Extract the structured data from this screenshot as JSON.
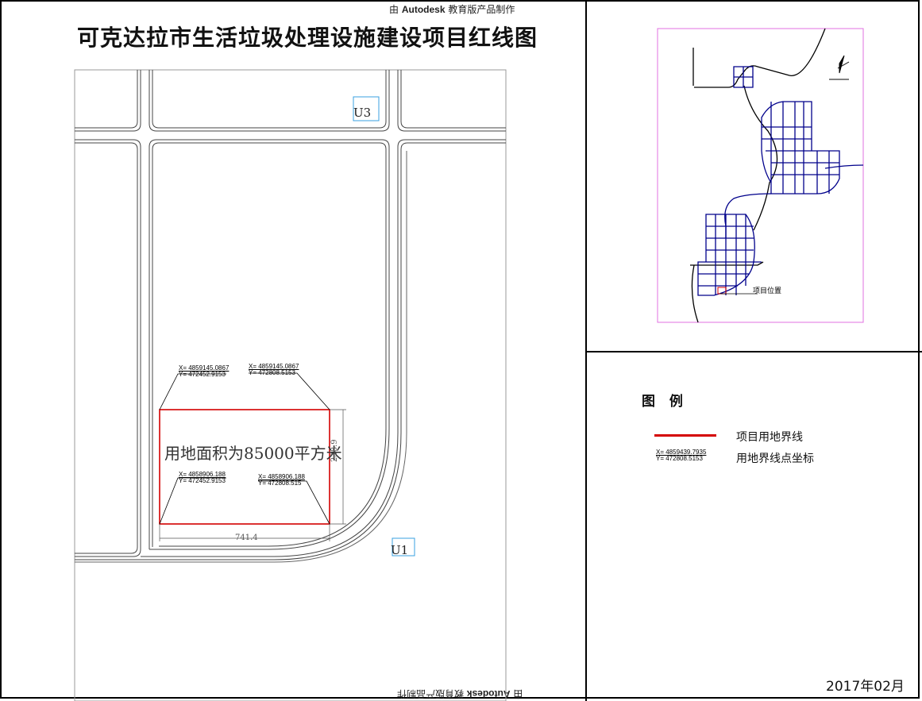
{
  "watermark": {
    "top": {
      "prefix": "由 ",
      "brand": "Autodesk",
      "suffix": " 教育版产品制作"
    },
    "bottom": {
      "prefix": "由 ",
      "brand": "Autodesk",
      "suffix": " 教育版产品制作"
    }
  },
  "title": "可克达拉市生活垃圾处理设施建设项目红线图",
  "site": {
    "area_label": "用地面积为85000平方米",
    "width_dimension": "741.4",
    "height_dimension": "238.9",
    "boundary_color": "#d40000",
    "corners": {
      "top_left": {
        "x": "X= 4859145.0867",
        "y": "Y= 472452.9153"
      },
      "top_right": {
        "x": "X= 4859145.0867",
        "y": "Y= 472808.5153"
      },
      "bottom_left": {
        "x": "X= 4858906.188",
        "y": "Y= 472452.9153"
      },
      "bottom_right": {
        "x": "X= 4858906.188",
        "y": "Y= 472808.515"
      }
    }
  },
  "markers": {
    "u3": "U3",
    "u1": "U1"
  },
  "location_map": {
    "project_label": "项目位置",
    "road_color": "#00008b",
    "frame_color": "#e070e0"
  },
  "legend": {
    "title": "图 例",
    "items": [
      {
        "label": "项目用地界线"
      },
      {
        "label": "用地界线点坐标",
        "sample_x": "X= 4859439.7935",
        "sample_y": "Y= 472808.5153"
      }
    ]
  },
  "date": "2017年02月"
}
